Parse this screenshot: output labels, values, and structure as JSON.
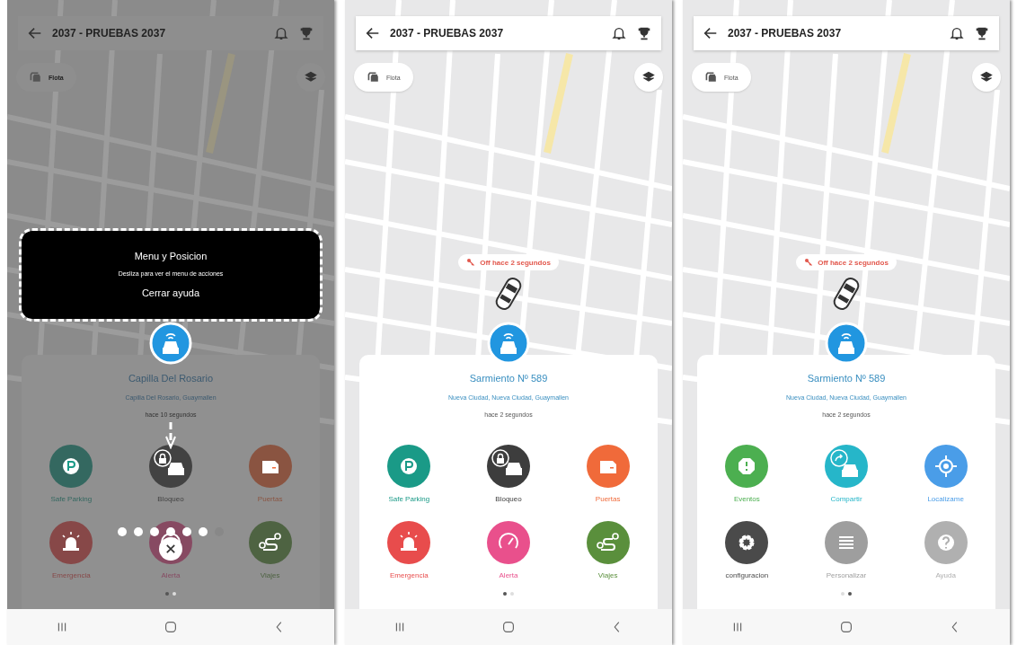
{
  "screens": [
    {
      "title": "2037 - PRUEBAS 2037",
      "fleet_label": "Flota",
      "location": {
        "name": "Capilla Del Rosario",
        "address": "Capilla Del Rosario, Guaymallen",
        "time": "hace 10 segundos"
      },
      "actions": [
        {
          "label": "Safe Parking",
          "kind": "parking",
          "color": "#346860"
        },
        {
          "label": "Bloqueo",
          "kind": "lock-car",
          "color": "#424242"
        },
        {
          "label": "Puertas",
          "kind": "door",
          "color": "#8a5441"
        },
        {
          "label": "Emergencia",
          "kind": "siren",
          "color": "#874848"
        },
        {
          "label": "Alerta",
          "kind": "gauge",
          "color": "#874a62"
        },
        {
          "label": "Viajes",
          "kind": "route",
          "color": "#4e6342"
        }
      ],
      "pages": [
        {
          "selected": true
        },
        {
          "selected": false
        }
      ],
      "help": {
        "title": "Menu y Posicion",
        "text": "Desliza para ver el menu de acciones",
        "close_label": "Cerrar ayuda",
        "steps": [
          {
            "selected": false
          },
          {
            "selected": false
          },
          {
            "selected": false
          },
          {
            "selected": false
          },
          {
            "selected": false
          },
          {
            "selected": false
          },
          {
            "selected": true
          }
        ]
      }
    },
    {
      "title": "2037 - PRUEBAS 2037",
      "fleet_label": "Flota",
      "status": "Off hace 2 segundos",
      "location": {
        "name": "Sarmiento Nº 589",
        "address": "Nueva Ciudad, Nueva Ciudad, Guaymallen",
        "time": "hace 2 segundos"
      },
      "actions": [
        {
          "label": "Safe Parking",
          "kind": "parking",
          "color": "#1a9a87"
        },
        {
          "label": "Bloqueo",
          "kind": "lock-car",
          "color": "#3d3d3d"
        },
        {
          "label": "Puertas",
          "kind": "door",
          "color": "#f06a3a"
        },
        {
          "label": "Emergencia",
          "kind": "siren",
          "color": "#e84c4c"
        },
        {
          "label": "Alerta",
          "kind": "gauge",
          "color": "#e9508c"
        },
        {
          "label": "Viajes",
          "kind": "route",
          "color": "#5a8f3c"
        }
      ],
      "pages": [
        {
          "selected": true
        },
        {
          "selected": false
        }
      ]
    },
    {
      "title": "2037 - PRUEBAS 2037",
      "fleet_label": "Flota",
      "status": "Off hace 2 segundos",
      "location": {
        "name": "Sarmiento Nº 589",
        "address": "Nueva Ciudad, Nueva Ciudad, Guaymallen",
        "time": "hace 2 segundos"
      },
      "actions": [
        {
          "label": "Eventos",
          "kind": "alert",
          "color": "#4caf50"
        },
        {
          "label": "Compartir",
          "kind": "share-car",
          "color": "#26b6c9"
        },
        {
          "label": "Localizame",
          "kind": "locate",
          "color": "#4a9de8"
        },
        {
          "label": "configuracion",
          "kind": "gear",
          "color": "#4a4a4a"
        },
        {
          "label": "Personalizar",
          "kind": "list",
          "color": "#9e9e9e"
        },
        {
          "label": "Ayuda",
          "kind": "help",
          "color": "#b0b0b0"
        }
      ],
      "pages": [
        {
          "selected": false
        },
        {
          "selected": true
        }
      ]
    }
  ]
}
